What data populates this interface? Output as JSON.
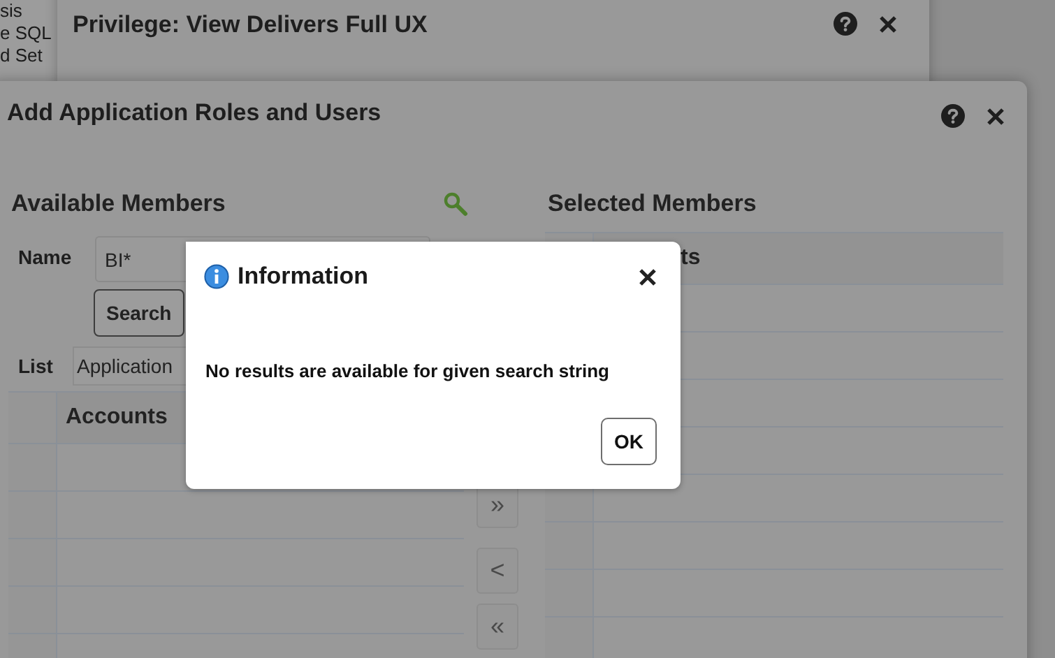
{
  "background_page": {
    "items": [
      "sis",
      "e SQL",
      "d Set"
    ]
  },
  "back_dialog": {
    "title": "Privilege: View Delivers Full UX"
  },
  "dialog": {
    "title": "Add Application Roles and Users",
    "available": {
      "heading": "Available Members",
      "name_label": "Name",
      "name_value": "BI*",
      "search_button": "Search",
      "list_label": "List",
      "list_value": "Application",
      "columns": [
        "Accounts"
      ]
    },
    "shuttle_buttons": [
      {
        "label": "»",
        "disabled": true
      },
      {
        "label": "<",
        "disabled": true
      },
      {
        "label": "«",
        "disabled": true
      }
    ],
    "selected": {
      "heading": "Selected Members",
      "columns": [
        "ts"
      ]
    }
  },
  "message_box": {
    "title": "Information",
    "message": "No results are available for given search string",
    "button": "OK"
  }
}
